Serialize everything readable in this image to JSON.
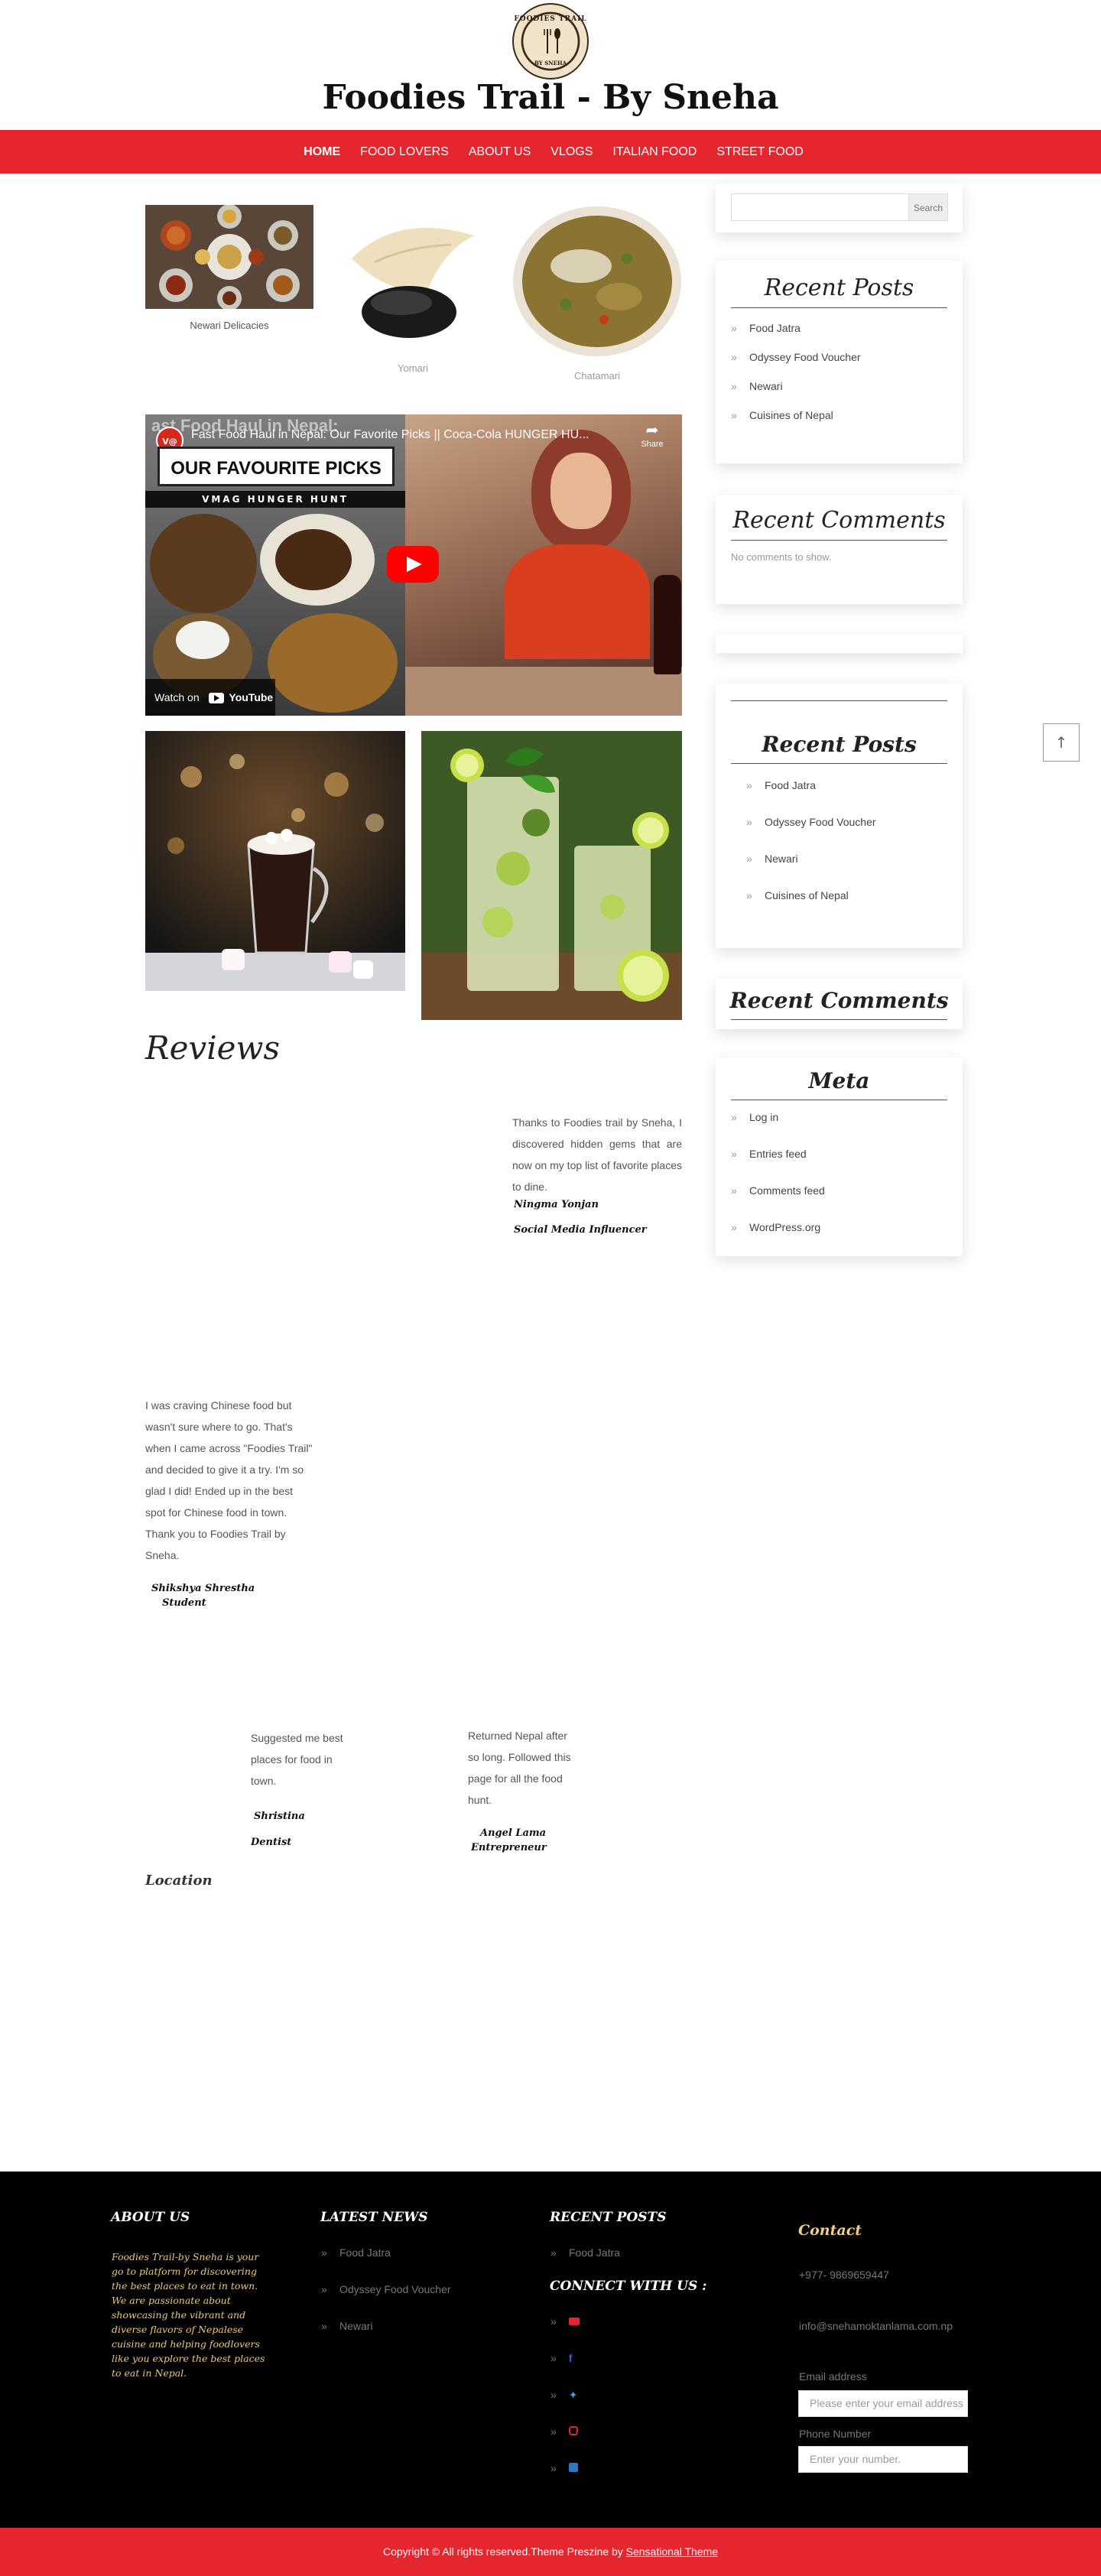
{
  "site": {
    "logo_text_top": "FOODIES TRAIL",
    "logo_text_bottom": "BY SNEHA",
    "title": "Foodies Trail - By Sneha"
  },
  "nav": {
    "items": [
      "HOME",
      "FOOD LOVERS",
      "ABOUT US",
      "VLOGS",
      "ITALIAN FOOD",
      "STREET FOOD"
    ],
    "active": "HOME"
  },
  "gallery": {
    "captions": [
      "Newari Delicacies",
      "Yomari",
      "Chatamari"
    ]
  },
  "video": {
    "ghost_title": "ast Food Haul in Nepal:",
    "title": "Fast Food Haul in Nepal: Our Favorite Picks || Coca-Cola HUNGER HU...",
    "channel_badge": "V@",
    "banner": "OUR FAVOURITE PICKS",
    "subbanner": "VMAG HUNGER HUNT",
    "share_label": "Share",
    "watch_label": "Watch on",
    "youtube_label": "YouTube"
  },
  "reviews": {
    "title": "Reviews",
    "items": [
      {
        "text": "Thanks to Foodies trail by Sneha, I discovered hidden gems that are now on my top list of favorite places to dine.",
        "name": "Ningma Yonjan",
        "role": "Social Media Influencer"
      },
      {
        "text": "I was craving Chinese food but wasn't sure where to go. That's when I came across \"Foodies Trail\" and decided to give it a try. I'm so glad I did! Ended up in the best spot for Chinese food in town. Thank you to Foodies Trail by Sneha.",
        "name": "Shikshya Shrestha",
        "role": "Student"
      },
      {
        "text": "Suggested me best places for food in town.",
        "name": "Shristina",
        "role": "Dentist"
      },
      {
        "text": "Returned Nepal after so long. Followed this page for all the food hunt.",
        "name": "Angel Lama",
        "role": "Entrepreneur"
      }
    ]
  },
  "location": {
    "title": "Location"
  },
  "sidebar": {
    "search_button": "Search",
    "recent_posts_title": "Recent Posts",
    "recent_posts": [
      "Food Jatra",
      "Odyssey Food Voucher",
      "Newari",
      "Cuisines of Nepal"
    ],
    "recent_comments_title": "Recent Comments",
    "no_comments": "No comments to show.",
    "meta_title": "Meta",
    "meta_items": [
      "Log in",
      "Entries feed",
      "Comments feed",
      "WordPress.org"
    ],
    "scroll_top_icon": "arrow-up-icon"
  },
  "footer": {
    "about_title": "ABOUT US",
    "about_text": "Foodies Trail-by Sneha is your go to platform for discovering the best places to eat in town. We are passionate about showcasing the vibrant and diverse flavors of Nepalese cuisine and helping foodlovers like you explore the best places to eat in Nepal.",
    "latest_news_title": "LATEST NEWS",
    "latest_news": [
      "Food Jatra",
      "Odyssey Food Voucher",
      "Newari"
    ],
    "recent_posts_title": "RECENT POSTS",
    "recent_posts": [
      "Food Jatra"
    ],
    "connect_title": "CONNECT WITH US :",
    "social_icons": [
      "youtube-icon",
      "facebook-icon",
      "twitter-icon",
      "instagram-icon",
      "linkedin-icon"
    ],
    "contact_title": "Contact",
    "phone": "+977- 9869659447",
    "email": "info@snehamoktanlama.com.np",
    "email_label": "Email address",
    "email_placeholder": "Please enter your email address",
    "phone_label": "Phone Number",
    "phone_placeholder": "Enter your number."
  },
  "copyright": {
    "text": "Copyright © All rights reserved.Theme Preszine by ",
    "link": "Sensational Theme"
  },
  "colors": {
    "brand_red": "#e4262f",
    "footer_bg": "#000000",
    "footer_gold": "#e7c97b"
  }
}
